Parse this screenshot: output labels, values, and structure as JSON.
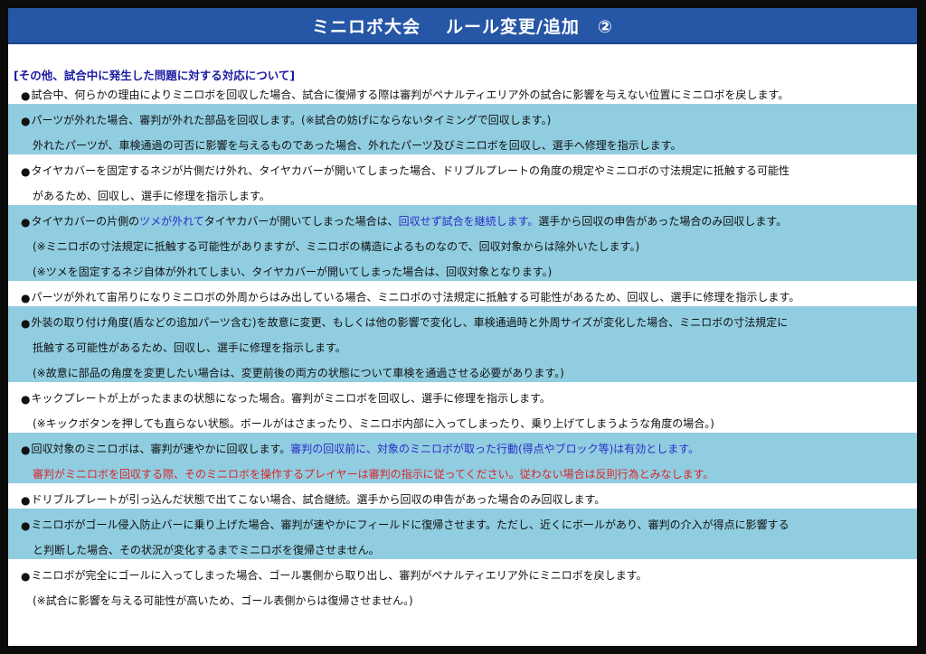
{
  "title": "ミニロボ大会",
  "title_sub": "ルール変更/追加　②",
  "section_heading": "[その他、試合中に発生した問題に対する対応について]",
  "bullet_symbol": "●",
  "items": [
    {
      "l1": "試合中、何らかの理由によりミニロボを回収した場合、試合に復帰する際は審判がペナルティエリア外の試合に影響を与えない位置にミニロボを戻します。"
    },
    {
      "l1": "パーツが外れた場合、審判が外れた部品を回収します。(※試合の妨げにならないタイミングで回収します。)",
      "l2": "外れたパーツが、車検通過の可否に影響を与えるものであった場合、外れたパーツ及びミニロボを回収し、選手へ修理を指示します。"
    },
    {
      "l1": "タイヤカバーを固定するネジが片側だけ外れ、タイヤカバーが開いてしまった場合、ドリブルプレートの角度の規定やミニロボの寸法規定に抵触する可能性",
      "l2": "があるため、回収し、選手に修理を指示します。"
    },
    {
      "l1_a": "タイヤカバーの片側の",
      "l1_b": "ツメが外れて",
      "l1_c": "タイヤカバーが開いてしまった場合は、",
      "l1_d": "回収せず試合を継続します。",
      "l1_e": "選手から回収の申告があった場合のみ回収します。",
      "l2": "(※ミニロボの寸法規定に抵触する可能性がありますが、ミニロボの構造によるものなので、回収対象からは除外いたします。)",
      "l3": "(※ツメを固定するネジ自体が外れてしまい、タイヤカバーが開いてしまった場合は、回収対象となります。)"
    },
    {
      "l1": "パーツが外れて宙吊りになりミニロボの外周からはみ出している場合、ミニロボの寸法規定に抵触する可能性があるため、回収し、選手に修理を指示します。"
    },
    {
      "l1": "外装の取り付け角度(盾などの追加パーツ含む)を故意に変更、もしくは他の影響で変化し、車検通過時と外周サイズが変化した場合、ミニロボの寸法規定に",
      "l2": "抵触する可能性があるため、回収し、選手に修理を指示します。",
      "l3": "(※故意に部品の角度を変更したい場合は、変更前後の両方の状態について車検を通過させる必要があります。)"
    },
    {
      "l1": "キックプレートが上がったままの状態になった場合。審判がミニロボを回収し、選手に修理を指示します。",
      "l2": "(※キックボタンを押しても直らない状態。ボールがはさまったり、ミニロボ内部に入ってしまったり、乗り上げてしまうような角度の場合。)"
    },
    {
      "l1_a": "回収対象のミニロボは、審判が速やかに回収します。",
      "l1_b": "審判の回収前に、対象のミニロボが取った行動(得点やブロック等)は有効とします。",
      "l2": "審判がミニロボを回収する際、そのミニロボを操作するプレイヤーは審判の指示に従ってください。従わない場合は反則行為とみなします。"
    },
    {
      "l1": "ドリブルプレートが引っ込んだ状態で出てこない場合、試合継続。選手から回収の申告があった場合のみ回収します。"
    },
    {
      "l1": "ミニロボがゴール侵入防止バーに乗り上げた場合、審判が速やかにフィールドに復帰させます。ただし、近くにボールがあり、審判の介入が得点に影響する",
      "l2": "と判断した場合、その状況が変化するまでミニロボを復帰させません。"
    },
    {
      "l1": "ミニロボが完全にゴールに入ってしまった場合、ゴール裏側から取り出し、審判がペナルティエリア外にミニロボを戻します。",
      "l2": "(※試合に影響を与える可能性が高いため、ゴール表側からは復帰させません。)"
    }
  ],
  "colors": {
    "title_bg": "#2656a6",
    "band": "#90cde0",
    "heading": "#1a1aa0",
    "highlight_blue": "#2d2dc8",
    "highlight_red": "#d8262c"
  }
}
